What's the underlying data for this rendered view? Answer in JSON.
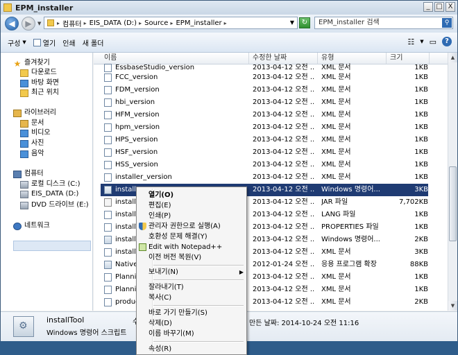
{
  "window": {
    "title": "EPM_installer",
    "minimize": "_",
    "maximize": "□",
    "close": "X"
  },
  "address": {
    "crumbs": [
      "컴퓨터",
      "EIS_DATA (D:)",
      "Source",
      "EPM_installer"
    ],
    "search_placeholder": "EPM_installer 검색"
  },
  "toolbar": {
    "organize": "구성",
    "open": "열기",
    "print": "인쇄",
    "new_folder": "새 폴더",
    "help": "?"
  },
  "sidebar": {
    "favorites": "즐겨찾기",
    "downloads": "다운로드",
    "desktop": "바탕 화면",
    "recent": "최근 위치",
    "libraries": "라이브러리",
    "documents": "문서",
    "videos": "비디오",
    "pictures": "사진",
    "music": "음악",
    "computer": "컴퓨터",
    "local_disk": "로컬 디스크 (C:)",
    "eis_data": "EIS_DATA (D:)",
    "dvd": "DVD 드라이브 (E:)",
    "network": "네트워크"
  },
  "columns": {
    "name": "이름",
    "date": "수정한 날짜",
    "type": "유형",
    "size": "크기"
  },
  "files": [
    {
      "name": "EssbaseStudio_version",
      "date": "2013-04-12 오전 ...",
      "type": "XML 문서",
      "size": "1KB"
    },
    {
      "name": "FCC_version",
      "date": "2013-04-12 오전 ...",
      "type": "XML 문서",
      "size": "1KB"
    },
    {
      "name": "FDM_version",
      "date": "2013-04-12 오전 ...",
      "type": "XML 문서",
      "size": "1KB"
    },
    {
      "name": "hbi_version",
      "date": "2013-04-12 오전 ...",
      "type": "XML 문서",
      "size": "1KB"
    },
    {
      "name": "HFM_version",
      "date": "2013-04-12 오전 ...",
      "type": "XML 문서",
      "size": "1KB"
    },
    {
      "name": "hpm_version",
      "date": "2013-04-12 오전 ...",
      "type": "XML 문서",
      "size": "1KB"
    },
    {
      "name": "HPS_version",
      "date": "2013-04-12 오전 ...",
      "type": "XML 문서",
      "size": "1KB"
    },
    {
      "name": "HSF_version",
      "date": "2013-04-12 오전 ...",
      "type": "XML 문서",
      "size": "1KB"
    },
    {
      "name": "HSS_version",
      "date": "2013-04-12 오전 ...",
      "type": "XML 문서",
      "size": "1KB"
    },
    {
      "name": "installer_version",
      "date": "2013-04-12 오전 ...",
      "type": "XML 문서",
      "size": "1KB"
    },
    {
      "name": "installT",
      "date": "2013-04-12 오전 ...",
      "type": "Windows 명령어...",
      "size": "3KB"
    },
    {
      "name": "installT",
      "date": "2013-04-12 오전 ...",
      "type": "JAR 파일",
      "size": "7,702KB"
    },
    {
      "name": "installT",
      "date": "2013-04-12 오전 ...",
      "type": "LANG 파일",
      "size": "1KB"
    },
    {
      "name": "installT",
      "date": "2013-04-12 오전 ...",
      "type": "PROPERTIES 파일",
      "size": "1KB"
    },
    {
      "name": "installT",
      "date": "2013-04-12 오전 ...",
      "type": "Windows 명령어...",
      "size": "2KB"
    },
    {
      "name": "installT",
      "date": "2013-04-12 오전 ...",
      "type": "XML 문서",
      "size": "3KB"
    },
    {
      "name": "Native",
      "date": "2012-01-24 오전 ...",
      "type": "응용 프로그램 확장",
      "size": "88KB"
    },
    {
      "name": "Planni",
      "date": "2013-04-12 오전 ...",
      "type": "XML 문서",
      "size": "1KB"
    },
    {
      "name": "Planni",
      "date": "2013-04-12 오전 ...",
      "type": "XML 문서",
      "size": "1KB"
    },
    {
      "name": "produc",
      "date": "2013-04-12 오전 ...",
      "type": "XML 문서",
      "size": "2KB"
    }
  ],
  "context_menu": {
    "open": "열기(O)",
    "edit": "편집(E)",
    "print": "인쇄(P)",
    "run_as_admin": "관리자 권한으로 실행(A)",
    "troubleshoot": "호환성 문제 해결(Y)",
    "notepad": "Edit with Notepad++",
    "restore": "이전 버전 복원(V)",
    "send_to": "보내기(N)",
    "cut": "잘라내기(T)",
    "copy": "복사(C)",
    "shortcut": "바로 가기 만들기(S)",
    "delete": "삭제(D)",
    "rename": "이름 바꾸기(M)",
    "properties": "속성(R)"
  },
  "details": {
    "name": "installTool",
    "type": "Windows 명령어 스크립트",
    "partial": "수",
    "modified": "만든 날짜: 2014-10-24 오전 11:16"
  }
}
